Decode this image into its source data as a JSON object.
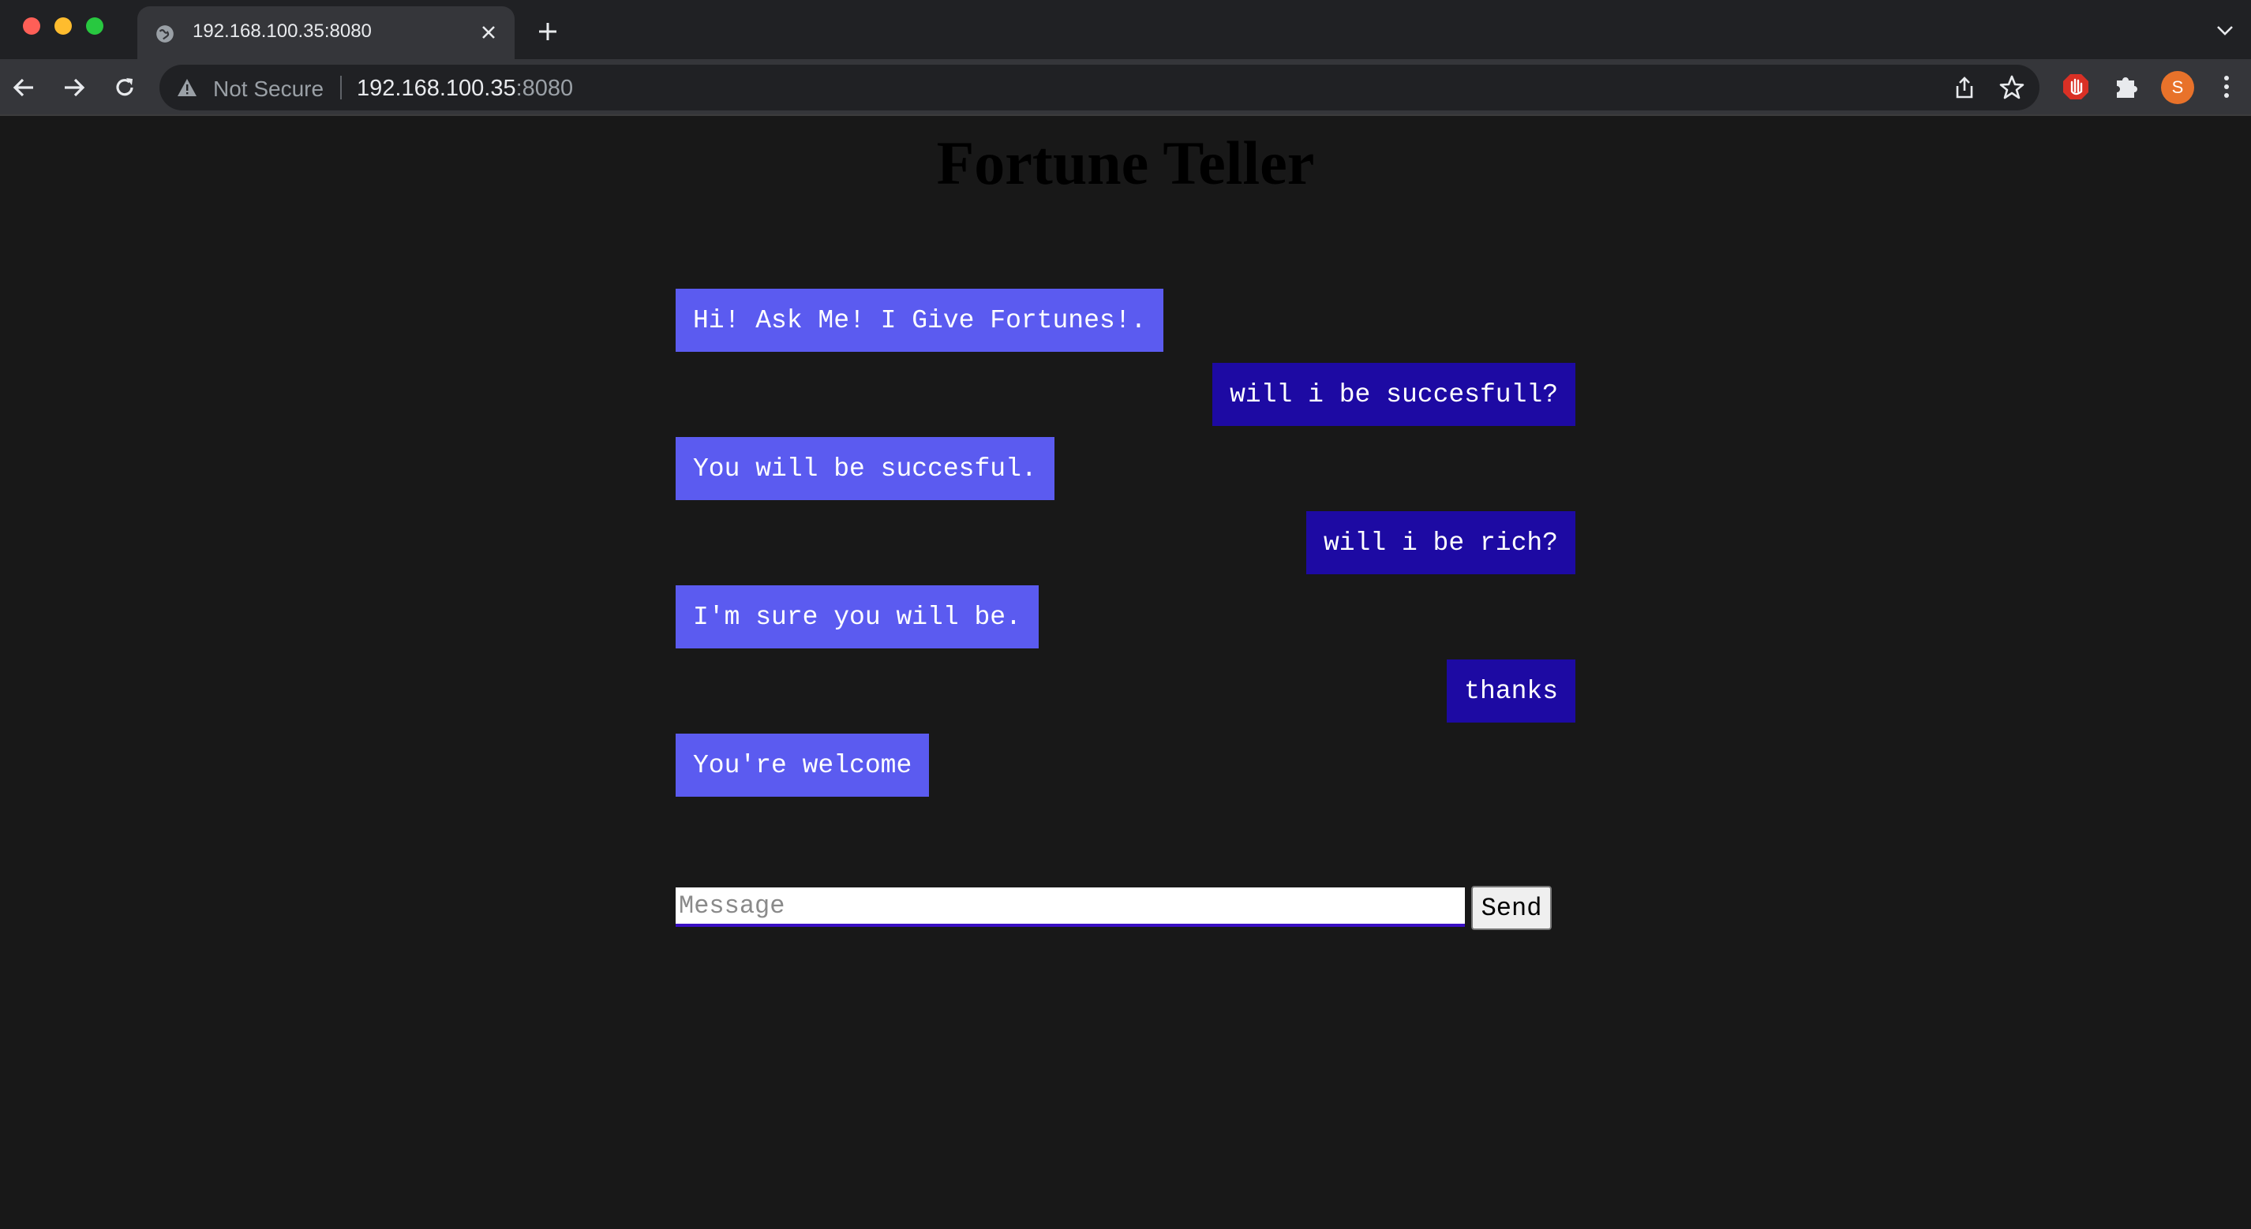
{
  "browser": {
    "tab": {
      "title": "192.168.100.35:8080"
    },
    "omnibox": {
      "security_label": "Not Secure",
      "host": "192.168.100.35",
      "port": ":8080"
    },
    "profile_initial": "S",
    "icons": {
      "tab_favicon": "globe-icon",
      "tab_close": "close-icon",
      "new_tab": "plus-icon",
      "tab_list": "chevron-down-icon",
      "back": "arrow-left-icon",
      "forward": "arrow-right-icon",
      "reload": "reload-icon",
      "security": "warning-icon",
      "share": "share-icon",
      "bookmark": "star-icon",
      "extension_block": "stop-hand-icon",
      "extensions": "puzzle-icon",
      "menu": "kebab-menu-icon"
    }
  },
  "page": {
    "title": "Fortune Teller",
    "messages": [
      {
        "sender": "bot",
        "text": "Hi! Ask Me! I Give Fortunes!."
      },
      {
        "sender": "user",
        "text": "will i be succesfull?"
      },
      {
        "sender": "bot",
        "text": "You will be succesful."
      },
      {
        "sender": "user",
        "text": "will i be rich?"
      },
      {
        "sender": "bot",
        "text": "I'm sure you will be."
      },
      {
        "sender": "user",
        "text": "thanks"
      },
      {
        "sender": "bot",
        "text": "You're welcome"
      }
    ],
    "composer": {
      "placeholder": "Message",
      "value": "",
      "send_label": "Send"
    },
    "colors": {
      "background": "#181818",
      "bot_bubble": "#5b5bf0",
      "user_bubble": "#1d0aa3",
      "input_underline": "#3a0fc4"
    }
  }
}
